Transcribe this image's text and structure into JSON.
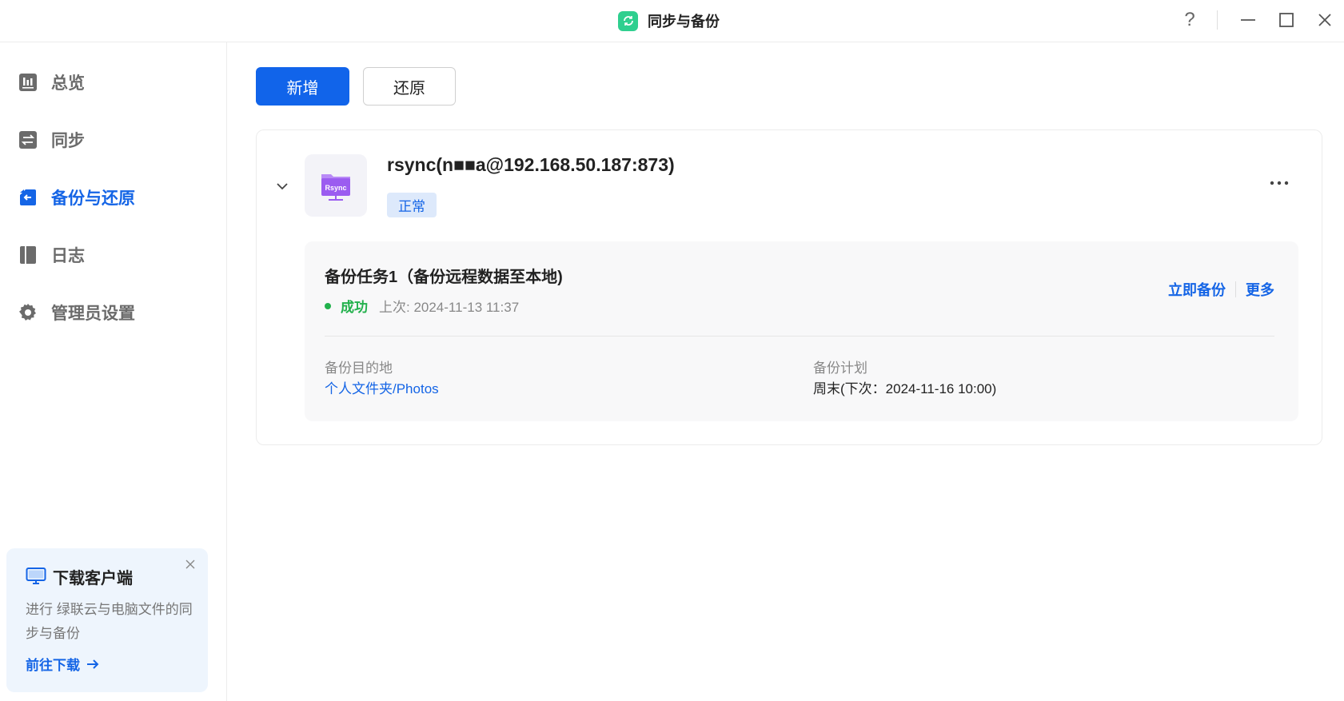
{
  "window": {
    "title": "同步与备份",
    "help_label": "?"
  },
  "sidebar": {
    "items": [
      {
        "label": "总览",
        "icon": "chart-bars-icon"
      },
      {
        "label": "同步",
        "icon": "sync-arrows-icon"
      },
      {
        "label": "备份与还原",
        "icon": "backup-restore-icon"
      },
      {
        "label": "日志",
        "icon": "log-book-icon"
      },
      {
        "label": "管理员设置",
        "icon": "gear-icon"
      }
    ],
    "active_index": 2
  },
  "promo": {
    "title": "下载客户端",
    "description": "进行 绿联云与电脑文件的同步与备份",
    "link_label": "前往下载"
  },
  "toolbar": {
    "add_label": "新增",
    "restore_label": "还原"
  },
  "connection": {
    "name": "rsync(n■■a@192.168.50.187:873)",
    "icon_text": "Rsync",
    "status": "正常"
  },
  "task": {
    "title": "备份任务1（备份远程数据至本地)",
    "result": "成功",
    "last_run": "上次: 2024-11-13 11:37",
    "backup_now_label": "立即备份",
    "more_label": "更多",
    "destination_label": "备份目的地",
    "destination_value": "个人文件夹/Photos",
    "schedule_label": "备份计划",
    "schedule_value": "周末(下次：2024-11-16 10:00)"
  },
  "colors": {
    "accent": "#1164ea",
    "success": "#22b14c",
    "app_icon": "#2fcf8f",
    "rsync_icon": "#9b5cf0"
  }
}
